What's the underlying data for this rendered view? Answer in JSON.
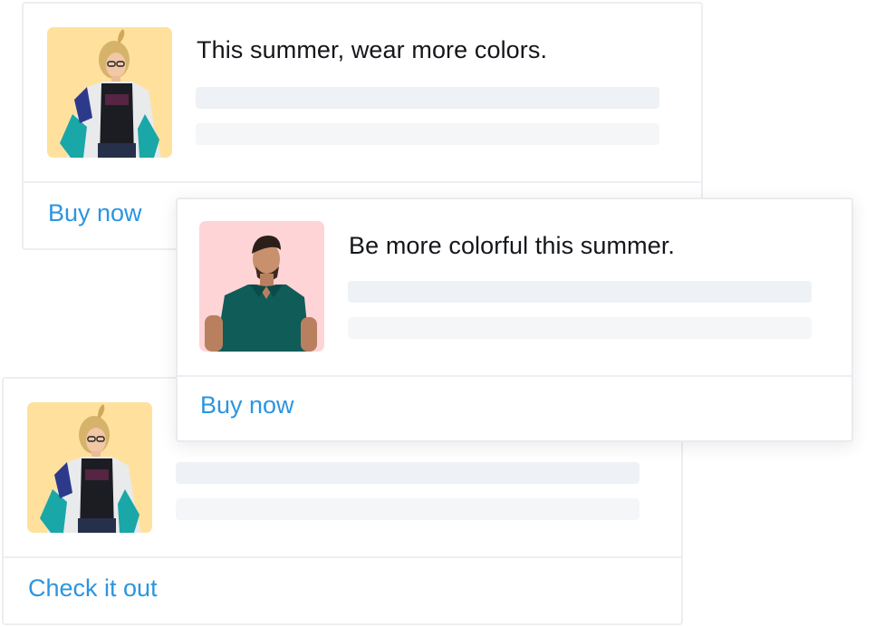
{
  "cards": [
    {
      "title": "This summer, wear more colors.",
      "cta": "Buy now",
      "image": "woman-in-colorful-jacket-photo",
      "thumb_bg": "#ffe19d"
    },
    {
      "title": "Be more colorful this summer.",
      "cta": "Buy now",
      "image": "man-in-green-polo-photo",
      "thumb_bg": "#ffd4d6"
    },
    {
      "title": "",
      "cta": "Check it out",
      "image": "woman-in-colorful-jacket-photo",
      "thumb_bg": "#ffe19d"
    }
  ],
  "colors": {
    "link": "#2b95e0",
    "bar_primary": "#eef1f5",
    "bar_secondary": "#f4f6f8",
    "border": "#eceef1"
  }
}
